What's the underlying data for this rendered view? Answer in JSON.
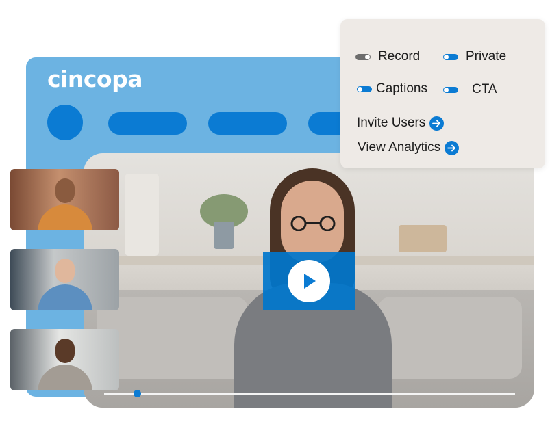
{
  "brand": {
    "logo_text": "cincopa"
  },
  "nav": {
    "pill_count": 3
  },
  "panel": {
    "toggles": [
      {
        "label": "Record",
        "state": "off",
        "color": "#6d6d6d"
      },
      {
        "label": "Private",
        "state": "on",
        "color": "#0b7bd3"
      },
      {
        "label": "Captions",
        "state": "on",
        "color": "#0b7bd3"
      },
      {
        "label": "CTA",
        "state": "on",
        "color": "#0b7bd3"
      }
    ],
    "links": [
      {
        "label": "Invite Users",
        "icon": "arrow-right-circle-icon"
      },
      {
        "label": "View Analytics",
        "icon": "arrow-right-circle-icon"
      }
    ]
  },
  "player": {
    "progress": 0.08,
    "accent_color": "#0b7bd3"
  },
  "participants": [
    {
      "id": "participant-1"
    },
    {
      "id": "participant-2"
    },
    {
      "id": "participant-3"
    }
  ],
  "colors": {
    "frame": "#6cb3e2",
    "accent": "#0b7bd3",
    "panel_bg": "#eeeae6"
  }
}
